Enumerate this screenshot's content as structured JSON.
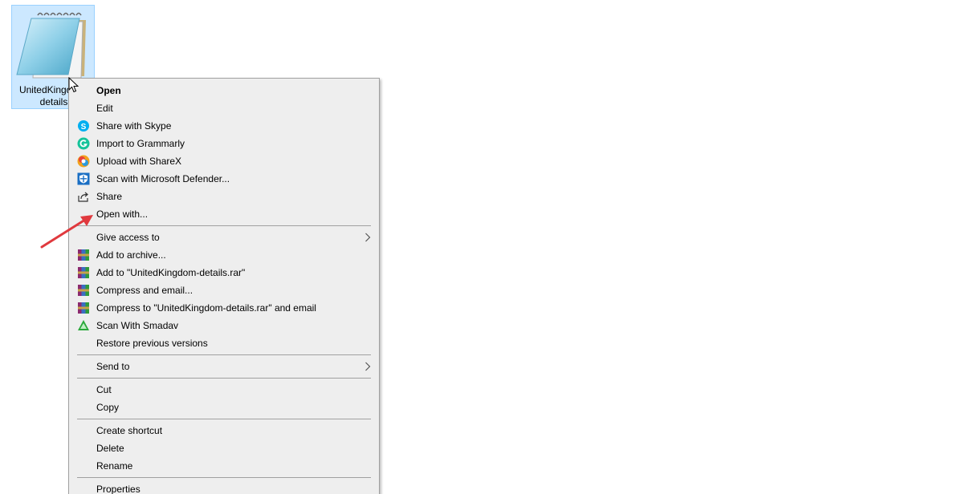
{
  "desktop": {
    "file": {
      "label_line1": "UnitedKingdom-",
      "label_line2": "details",
      "icon": "notepad-icon"
    }
  },
  "menu": {
    "items": [
      {
        "id": "open",
        "label": "Open",
        "bold": true,
        "icon": ""
      },
      {
        "id": "edit",
        "label": "Edit",
        "icon": ""
      },
      {
        "id": "skype",
        "label": "Share with Skype",
        "icon": "skype-icon"
      },
      {
        "id": "grammarly",
        "label": "Import to Grammarly",
        "icon": "grammarly-icon"
      },
      {
        "id": "sharex",
        "label": "Upload with ShareX",
        "icon": "sharex-icon"
      },
      {
        "id": "defender",
        "label": "Scan with Microsoft Defender...",
        "icon": "defender-icon"
      },
      {
        "id": "share",
        "label": "Share",
        "icon": "share-icon"
      },
      {
        "id": "openwith",
        "label": "Open with...",
        "icon": ""
      },
      {
        "id": "giveaccess",
        "label": "Give access to",
        "icon": "",
        "submenu": true
      },
      {
        "id": "addarchive",
        "label": "Add to archive...",
        "icon": "winrar-icon"
      },
      {
        "id": "addrar",
        "label": "Add to \"UnitedKingdom-details.rar\"",
        "icon": "winrar-icon"
      },
      {
        "id": "compressemail",
        "label": "Compress and email...",
        "icon": "winrar-icon"
      },
      {
        "id": "compressrar",
        "label": "Compress to \"UnitedKingdom-details.rar\" and email",
        "icon": "winrar-icon"
      },
      {
        "id": "smadav",
        "label": "Scan With Smadav",
        "icon": "smadav-icon"
      },
      {
        "id": "restore",
        "label": "Restore previous versions",
        "icon": ""
      },
      {
        "id": "sendto",
        "label": "Send to",
        "icon": "",
        "submenu": true
      },
      {
        "id": "cut",
        "label": "Cut",
        "icon": ""
      },
      {
        "id": "copy",
        "label": "Copy",
        "icon": ""
      },
      {
        "id": "shortcut",
        "label": "Create shortcut",
        "icon": ""
      },
      {
        "id": "delete",
        "label": "Delete",
        "icon": ""
      },
      {
        "id": "rename",
        "label": "Rename",
        "icon": ""
      },
      {
        "id": "properties",
        "label": "Properties",
        "icon": ""
      }
    ]
  },
  "colors": {
    "selection_bg": "#cce8ff",
    "menu_bg": "#eeeeee",
    "annotation_arrow": "#e0393e"
  }
}
